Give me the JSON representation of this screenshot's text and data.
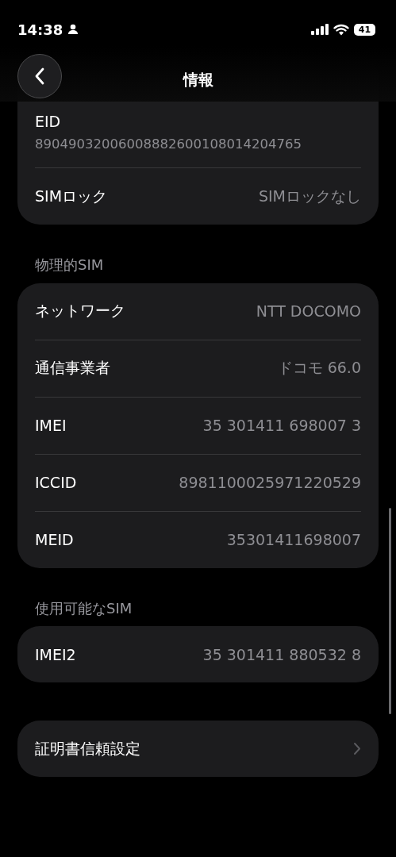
{
  "status_bar": {
    "time": "14:38",
    "battery": "41"
  },
  "nav": {
    "title": "情報"
  },
  "sections": [
    {
      "rows": [
        {
          "kind": "stacked",
          "label": "EID",
          "value": "89049032006008882600108014204765"
        },
        {
          "kind": "value",
          "label": "SIMロック",
          "value": "SIMロックなし"
        }
      ]
    },
    {
      "header": "物理的SIM",
      "rows": [
        {
          "kind": "value",
          "label": "ネットワーク",
          "value": "NTT DOCOMO"
        },
        {
          "kind": "value",
          "label": "通信事業者",
          "value": "ドコモ 66.0"
        },
        {
          "kind": "value",
          "label": "IMEI",
          "value": "35 301411 698007 3"
        },
        {
          "kind": "value",
          "label": "ICCID",
          "value": "8981100025971220529"
        },
        {
          "kind": "value",
          "label": "MEID",
          "value": "35301411698007"
        }
      ]
    },
    {
      "header": "使用可能なSIM",
      "rows": [
        {
          "kind": "value",
          "label": "IMEI2",
          "value": "35 301411 880532 8"
        }
      ]
    },
    {
      "rows": [
        {
          "kind": "link",
          "label": "証明書信頼設定"
        }
      ]
    }
  ]
}
